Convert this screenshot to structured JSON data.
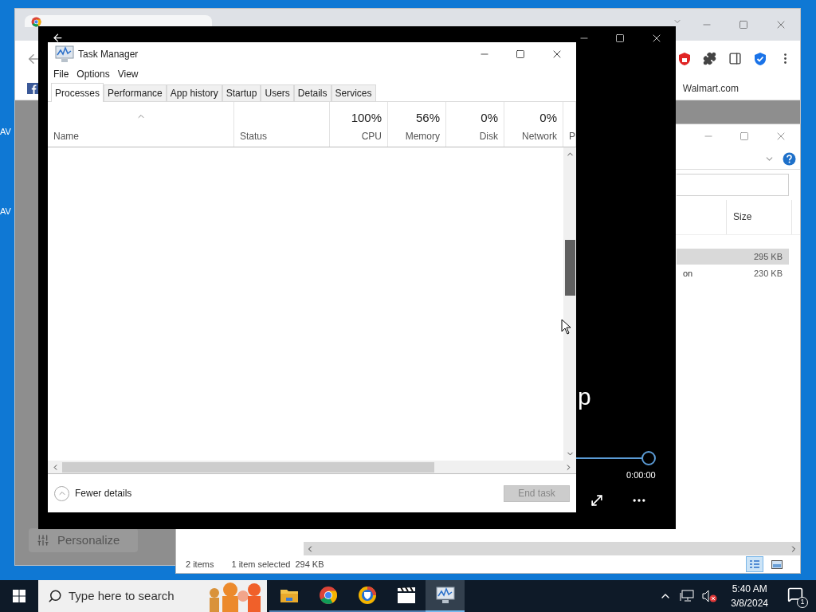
{
  "desktop": {
    "icons": [
      {
        "label": "AV"
      },
      {
        "label": "AV"
      }
    ]
  },
  "browser": {
    "bookmarks": [
      "Walmart.com"
    ],
    "side_panel": {
      "button": "Personalize"
    }
  },
  "explorer": {
    "column": "Size",
    "rows": [
      {
        "name": "",
        "size": "295 KB",
        "selected": true
      },
      {
        "name": "on",
        "size": "230 KB",
        "selected": false
      }
    ],
    "status": {
      "count": "2 items",
      "selection": "1 item selected",
      "size": "294 KB"
    },
    "views": [
      {
        "kind": "details",
        "selected": true
      },
      {
        "kind": "thumbnails",
        "selected": false
      }
    ]
  },
  "media_player": {
    "title_fragment": "p",
    "seek": {
      "level": 1
    },
    "time": "0:00:00"
  },
  "task_manager": {
    "title": "Task Manager",
    "menu": [
      "File",
      "Options",
      "View"
    ],
    "tabs": [
      {
        "label": "Processes",
        "selected": true
      },
      {
        "label": "Performance",
        "selected": false
      },
      {
        "label": "App history",
        "selected": false
      },
      {
        "label": "Startup",
        "selected": false
      },
      {
        "label": "Users",
        "selected": false
      },
      {
        "label": "Details",
        "selected": false
      },
      {
        "label": "Services",
        "selected": false
      }
    ],
    "columns": [
      {
        "label": "Name",
        "sorted": true
      },
      {
        "label": "Status",
        "sorted": false
      },
      {
        "label": "CPU",
        "usage": "100%",
        "sorted": false
      },
      {
        "label": "Memory",
        "usage": "56%",
        "sorted": false
      },
      {
        "label": "Disk",
        "usage": "0%",
        "sorted": false
      },
      {
        "label": "Network",
        "usage": "0%",
        "sorted": false
      },
      {
        "label": "P",
        "sorted": false
      }
    ],
    "details_toggle": "Fewer details",
    "end_task": {
      "label": "End task",
      "disabled": true
    }
  },
  "taskbar": {
    "search_placeholder": "Type here to search",
    "apps": [
      {
        "kind": "folder",
        "selected": false
      },
      {
        "kind": "chrome",
        "selected": false
      },
      {
        "kind": "browser",
        "selected": false
      },
      {
        "kind": "clapper",
        "selected": false
      },
      {
        "kind": "monitor",
        "selected": true
      }
    ],
    "time": "5:40 AM",
    "date": "3/8/2024",
    "notifications": "1"
  }
}
